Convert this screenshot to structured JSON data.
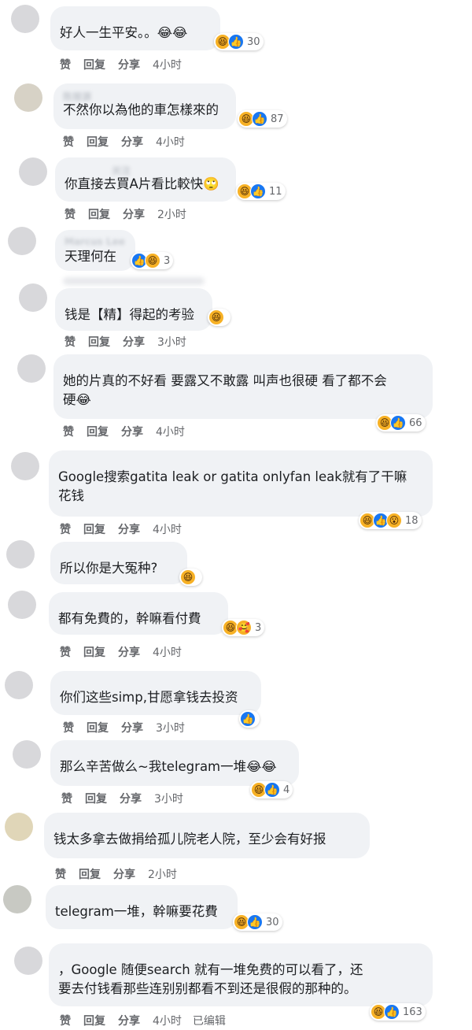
{
  "actions": {
    "like": "赞",
    "reply": "回复",
    "share": "分享",
    "edited": "已编辑"
  },
  "comments": [
    {
      "name": "",
      "text": "好人一生平安。。😂😂",
      "time": "4小时",
      "reactions": [
        "haha",
        "like"
      ],
      "count": "30"
    },
    {
      "name": "陈振源",
      "text": "不然你以為他的車怎樣來的",
      "time": "4小时",
      "reactions": [
        "haha",
        "like"
      ],
      "count": "87"
    },
    {
      "name": "关注",
      "text": "你直接去買A片看比較快🙄",
      "time": "2小时",
      "reactions": [
        "haha",
        "like"
      ],
      "count": "11"
    },
    {
      "name": "Marcus Lee",
      "text": "天理何在",
      "time": "",
      "reactions": [
        "like",
        "haha"
      ],
      "count": "3"
    },
    {
      "name": "",
      "text": "钱是【精】得起的考验",
      "time": "3小时",
      "reactions": [
        "haha"
      ],
      "count": ""
    },
    {
      "name": "",
      "text": "她的片真的不好看 要露又不敢露 叫声也很硬 看了都不会\n硬😂",
      "time": "4小时",
      "reactions": [
        "haha",
        "like"
      ],
      "count": "66"
    },
    {
      "name": "",
      "text": "Google搜索gatita leak or gatita onlyfan leak就有了干嘛\n花钱",
      "time": "4小时",
      "reactions": [
        "haha",
        "like",
        "wow"
      ],
      "count": "18"
    },
    {
      "name": "",
      "text": "所以你是大冤种?",
      "time": "",
      "reactions": [
        "haha"
      ],
      "count": ""
    },
    {
      "name": "",
      "text": "都有免費的，幹嘛看付費",
      "time": "4小时",
      "reactions": [
        "haha",
        "care"
      ],
      "count": "3"
    },
    {
      "name": "",
      "text": "你们这些simp,甘愿拿钱去投资",
      "time": "3小时",
      "reactions": [
        "like"
      ],
      "count": ""
    },
    {
      "name": "",
      "text": "那么辛苦做么~我telegram一堆😂😂",
      "time": "3小时",
      "reactions": [
        "haha",
        "like"
      ],
      "count": "4"
    },
    {
      "name": "",
      "text": "钱太多拿去做捐给孤儿院老人院，至少会有好报",
      "time": "2小时",
      "reactions": [],
      "count": ""
    },
    {
      "name": "",
      "text": "telegram一堆，幹嘛要花費",
      "time": "",
      "reactions": [
        "haha",
        "like"
      ],
      "count": "30"
    },
    {
      "name": "",
      "text": "，Google 随便search 就有一堆免费的可以看了，还\n要去付钱看那些连别别都看不到还是很假的那种的。",
      "time": "4小时",
      "reactions": [
        "haha",
        "like"
      ],
      "count": "163"
    }
  ],
  "icons": {
    "haha": "😆",
    "like": "👍",
    "wow": "😮",
    "care": "🥰"
  },
  "colors": {
    "bubble": "#f0f2f5",
    "like_blue": "#1877f2",
    "haha_yellow": "#f7b125",
    "meta_gray": "#65676b"
  }
}
